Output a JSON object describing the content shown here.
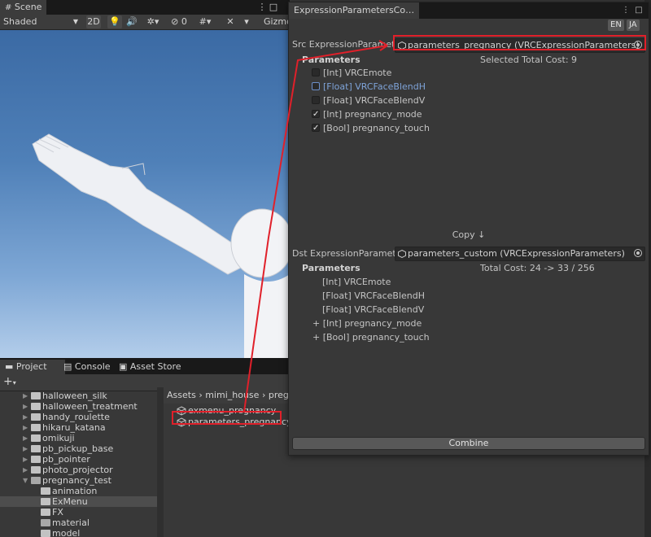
{
  "scene": {
    "tab_label": "Scene",
    "shading_mode": "Shaded",
    "mode_2d": "2D",
    "hidden_count": "0",
    "gizmos": "Gizmo"
  },
  "project_panel": {
    "tabs": [
      {
        "label": "Project"
      },
      {
        "label": "Console"
      },
      {
        "label": "Asset Store"
      }
    ],
    "add_label": "+",
    "tree": [
      {
        "label": "halloween_silk"
      },
      {
        "label": "halloween_treatment"
      },
      {
        "label": "handy_roulette"
      },
      {
        "label": "hikaru_katana"
      },
      {
        "label": "omikuji"
      },
      {
        "label": "pb_pickup_base"
      },
      {
        "label": "pb_pointer"
      },
      {
        "label": "photo_projector"
      },
      {
        "label": "pregnancy_test"
      },
      {
        "label": "animation"
      },
      {
        "label": "ExMenu"
      },
      {
        "label": "FX"
      },
      {
        "label": "material"
      },
      {
        "label": "model"
      }
    ],
    "breadcrumb": [
      "Assets",
      "mimi_house",
      "pregna"
    ],
    "assets": [
      {
        "label": "exmenu_pregnancy"
      },
      {
        "label": "parameters_pregnancy"
      }
    ]
  },
  "window": {
    "title": "ExpressionParametersCo…",
    "lang_buttons": [
      "EN",
      "JA"
    ],
    "src_label": "Src ExpressionParameters",
    "src_value": "parameters_pregnancy (VRCExpressionParameters)",
    "src_section": "Parameters",
    "src_cost": "Selected Total Cost: 9",
    "src_params": [
      {
        "label": "[Int] VRCEmote",
        "checked": false,
        "highlight": false
      },
      {
        "label": "[Float] VRCFaceBlendH",
        "checked": false,
        "highlight": true
      },
      {
        "label": "[Float] VRCFaceBlendV",
        "checked": false,
        "highlight": false
      },
      {
        "label": "[Int] pregnancy_mode",
        "checked": true,
        "highlight": false
      },
      {
        "label": "[Bool] pregnancy_touch",
        "checked": true,
        "highlight": false
      }
    ],
    "copy_label": "Copy ↓",
    "dst_label": "Dst ExpressionParameters",
    "dst_value": "parameters_custom (VRCExpressionParameters)",
    "dst_section": "Parameters",
    "dst_cost": "Total Cost: 24 -> 33 / 256",
    "dst_params": [
      {
        "label": "[Int] VRCEmote",
        "added": false
      },
      {
        "label": "[Float] VRCFaceBlendH",
        "added": false
      },
      {
        "label": "[Float] VRCFaceBlendV",
        "added": false
      },
      {
        "label": "+ [Int] pregnancy_mode",
        "added": true
      },
      {
        "label": "+ [Bool] pregnancy_touch",
        "added": true
      }
    ],
    "combine_label": "Combine"
  },
  "colors": {
    "highlight_red": "#e0202a",
    "selected_param_blue": "#7ea3d8",
    "panel_bg": "#383838"
  }
}
